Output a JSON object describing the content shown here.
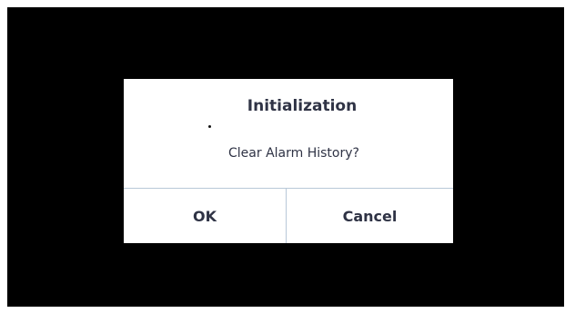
{
  "dialog": {
    "title": "Initialization",
    "message": "Clear Alarm History?",
    "ok_label": "OK",
    "cancel_label": "Cancel"
  }
}
